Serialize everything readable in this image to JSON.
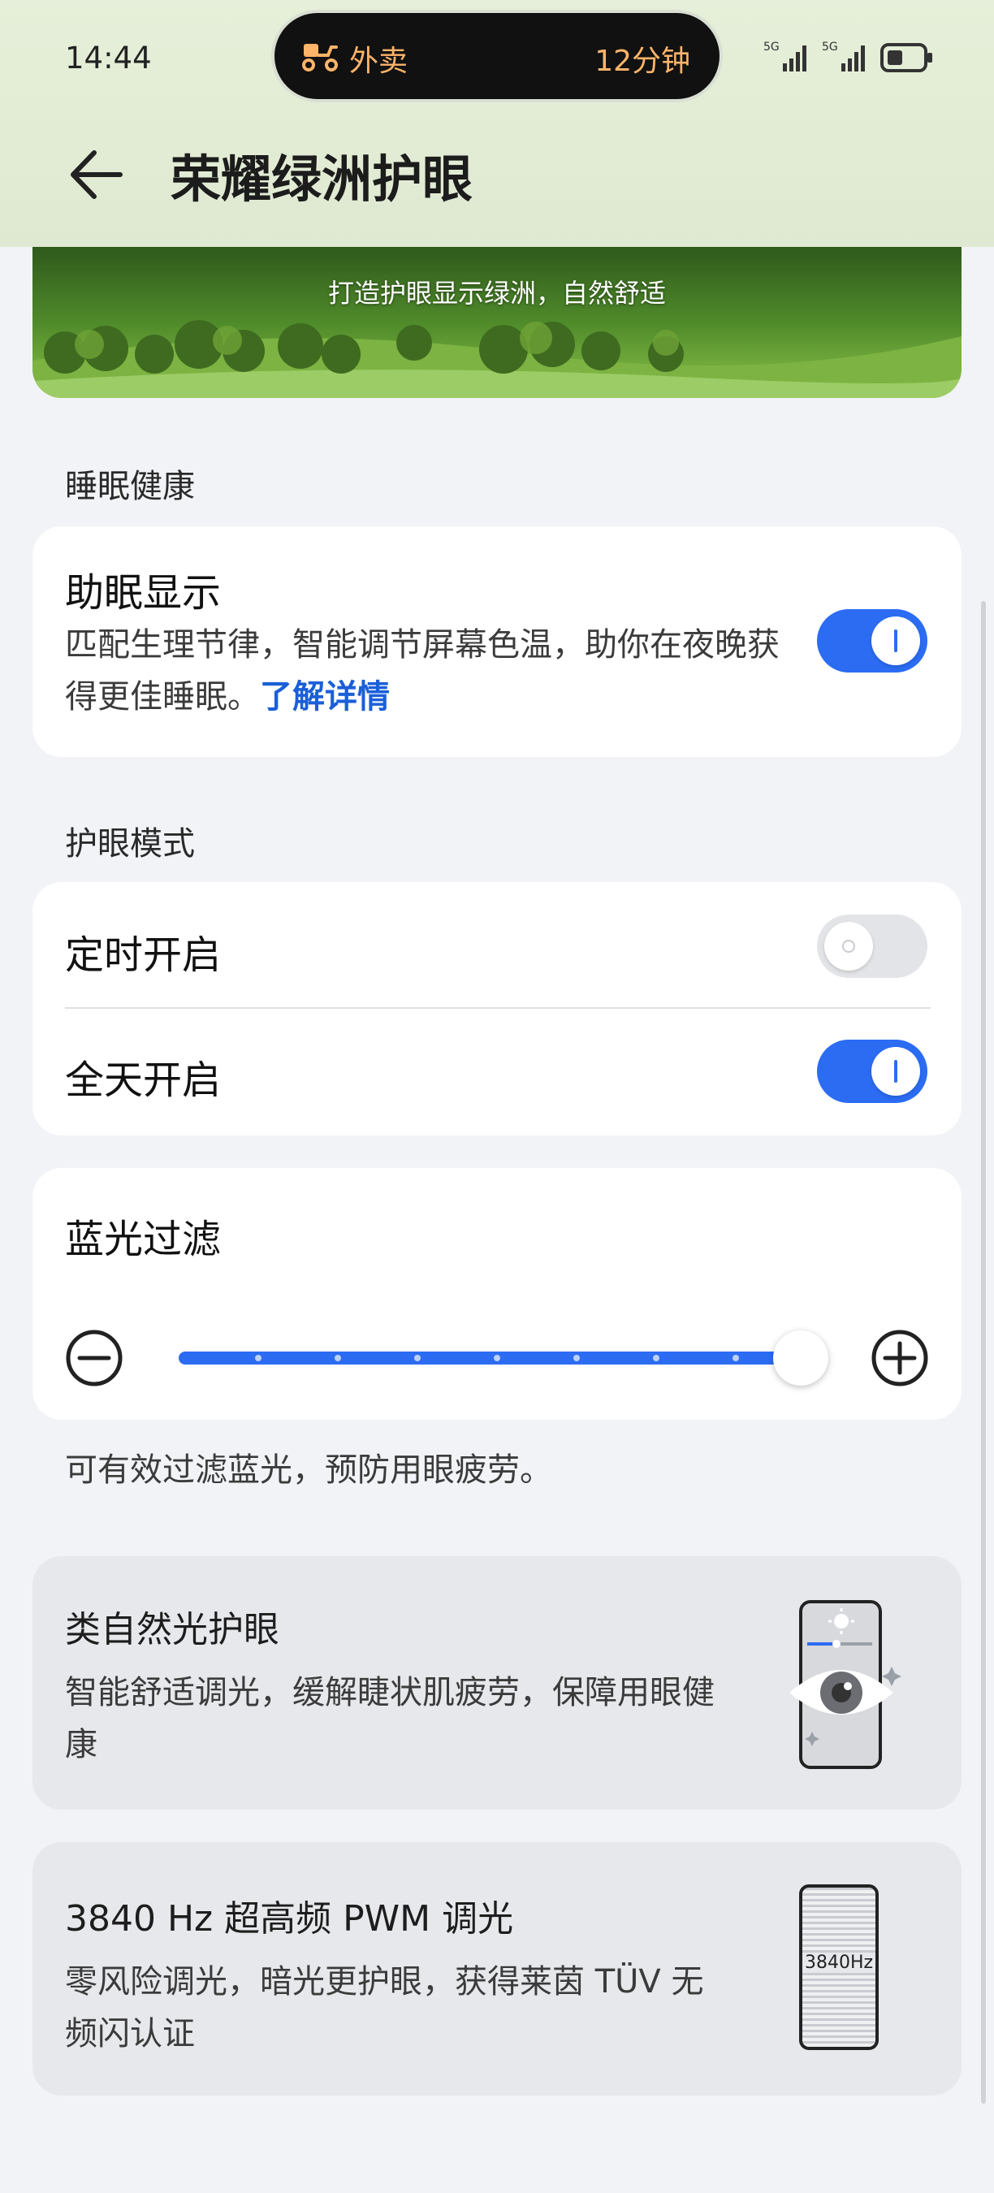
{
  "status_bar": {
    "time": "14:44",
    "island_app": "外卖",
    "island_eta": "12分钟",
    "network_1": "5G",
    "network_2": "5G"
  },
  "header": {
    "back_icon": "back-arrow-icon",
    "title": "荣耀绿洲护眼"
  },
  "banner": {
    "caption": "打造护眼显示绿洲，自然舒适"
  },
  "sleep_section": {
    "heading": "睡眠健康",
    "item": {
      "title": "助眠显示",
      "description": "匹配生理节律，智能调节屏幕色温，助你在夜晚获得更佳睡眠。",
      "link": "了解详情",
      "enabled": true
    }
  },
  "eye_mode_section": {
    "heading": "护眼模式",
    "items": [
      {
        "label": "定时开启",
        "enabled": false
      },
      {
        "label": "全天开启",
        "enabled": true
      }
    ]
  },
  "blue_light": {
    "title": "蓝光过滤",
    "level_fraction": 1.0,
    "description": "可有效过滤蓝光，预防用眼疲劳。"
  },
  "features": [
    {
      "title": "类自然光护眼",
      "description": "智能舒适调光，缓解睫状肌疲劳，保障用眼健康",
      "icon": "eye-phone-icon"
    },
    {
      "title": "3840 Hz 超高频 PWM 调光",
      "description": "零风险调光，暗光更护眼，获得莱茵 TÜV 无频闪认证",
      "icon": "pwm-phone-icon",
      "icon_label": "3840Hz"
    }
  ],
  "colors": {
    "accent": "#2b6cf3",
    "link": "#1b5fd8",
    "header_bg": "#e4edd7",
    "page_bg": "#f1f3f6"
  }
}
